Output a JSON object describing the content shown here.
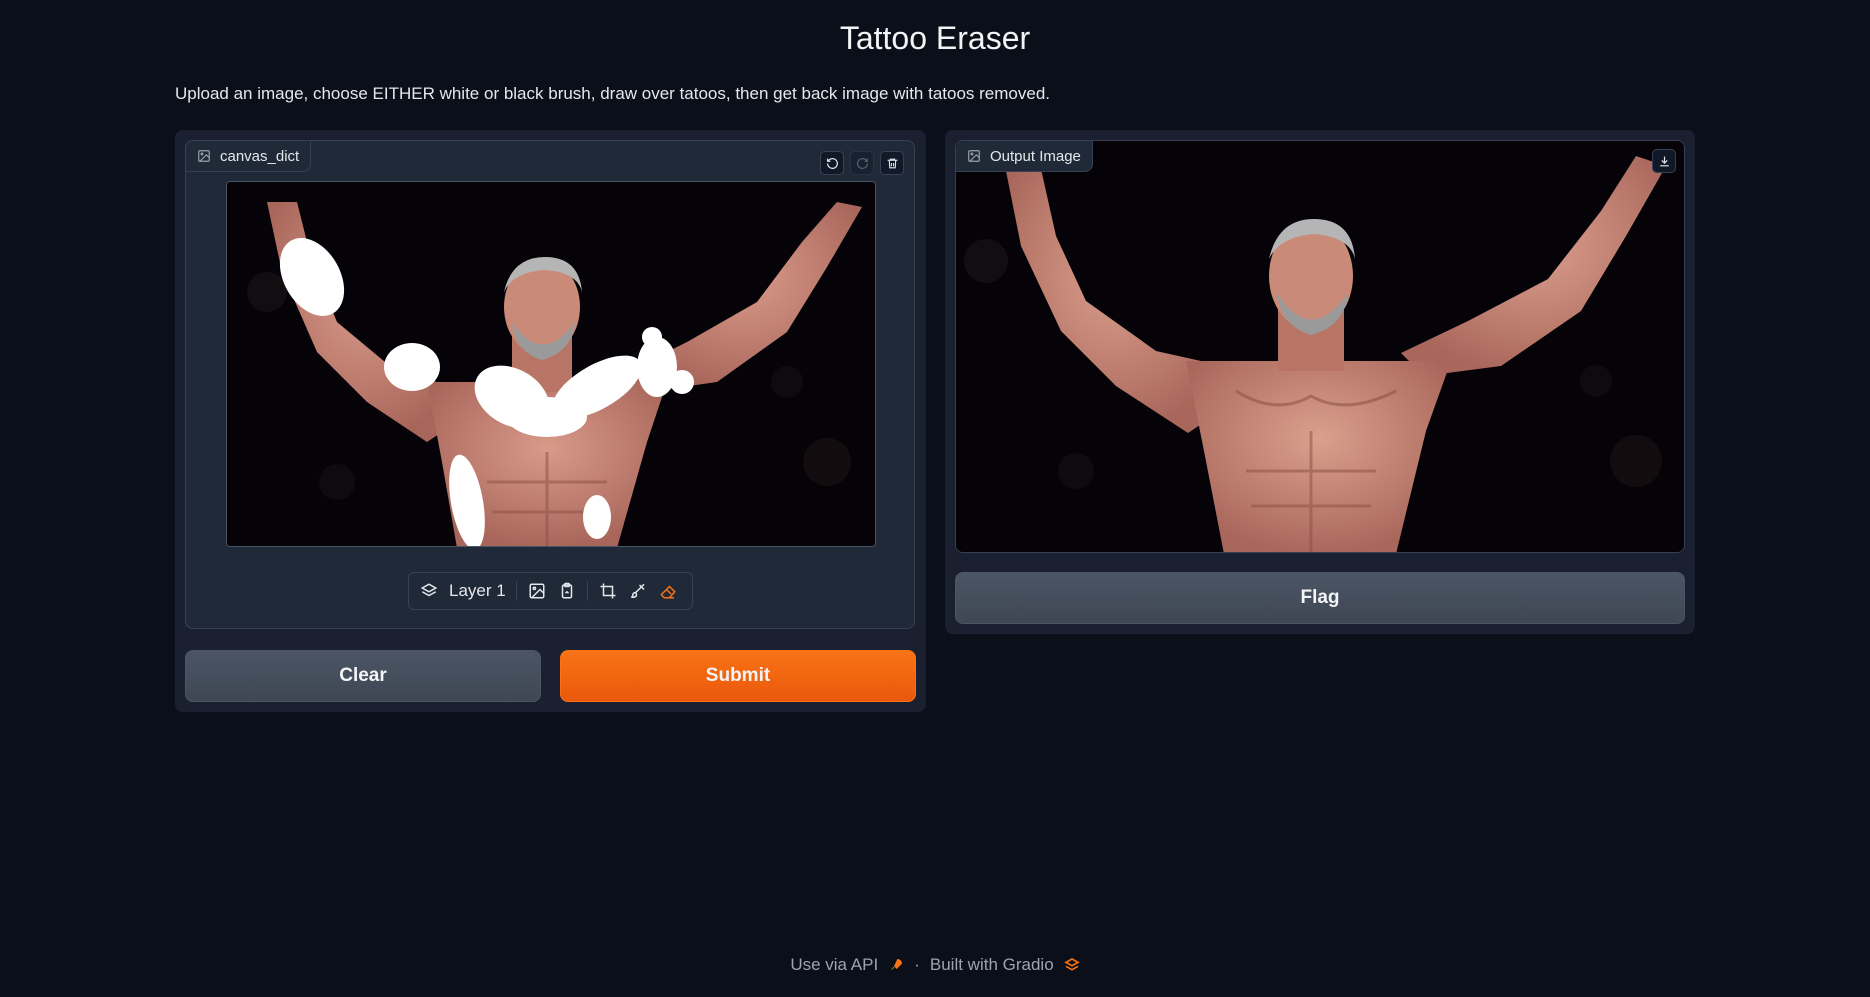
{
  "header": {
    "title": "Tattoo Eraser",
    "description": "Upload an image, choose EITHER white or black brush, draw over tatoos, then get back image with tatoos removed."
  },
  "editor": {
    "label": "canvas_dict",
    "layer_label": "Layer 1",
    "icons": [
      "image-icon",
      "undo-icon",
      "redo-icon",
      "trash-icon",
      "layers-icon",
      "upload-image-icon",
      "paste-icon",
      "crop-icon",
      "brush-icon",
      "eraser-icon"
    ]
  },
  "output": {
    "label": "Output Image",
    "icons": [
      "image-icon",
      "download-icon"
    ]
  },
  "buttons": {
    "clear": "Clear",
    "submit": "Submit",
    "flag": "Flag"
  },
  "footer": {
    "api_link": "Use via API",
    "separator": "·",
    "built_with": "Built with Gradio"
  },
  "colors": {
    "background": "#0b0f19",
    "panel": "#1a2030",
    "accent": "#f97316"
  }
}
